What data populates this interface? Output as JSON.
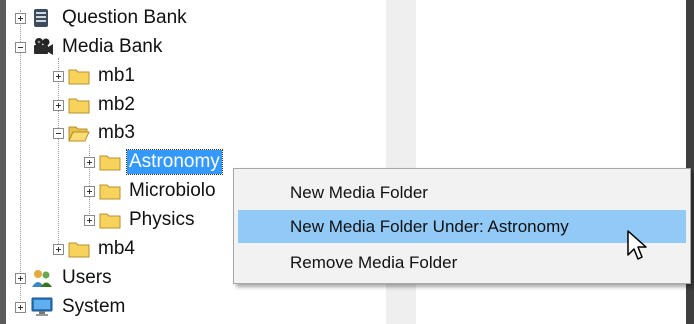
{
  "tree": {
    "question_bank": "Question Bank",
    "media_bank": "Media Bank",
    "mb1": "mb1",
    "mb2": "mb2",
    "mb3": "mb3",
    "astronomy": "Astronomy",
    "microbiology": "Microbiolo",
    "physics": "Physics",
    "mb4": "mb4",
    "users": "Users",
    "system": "System"
  },
  "context_menu": {
    "items": [
      "New Media Folder",
      "New Media Folder Under: Astronomy",
      "Remove Media Folder"
    ],
    "highlighted_index": 1
  },
  "icons": {
    "question_bank": "database-icon",
    "media_bank": "camera-icon",
    "folder": "folder-icon",
    "users": "users-icon",
    "system": "computer-icon",
    "cursor": "mouse-pointer-icon"
  },
  "colors": {
    "selection": "#3399ff",
    "menu_hover": "#91c9f7",
    "folder": "#f7d35b"
  }
}
